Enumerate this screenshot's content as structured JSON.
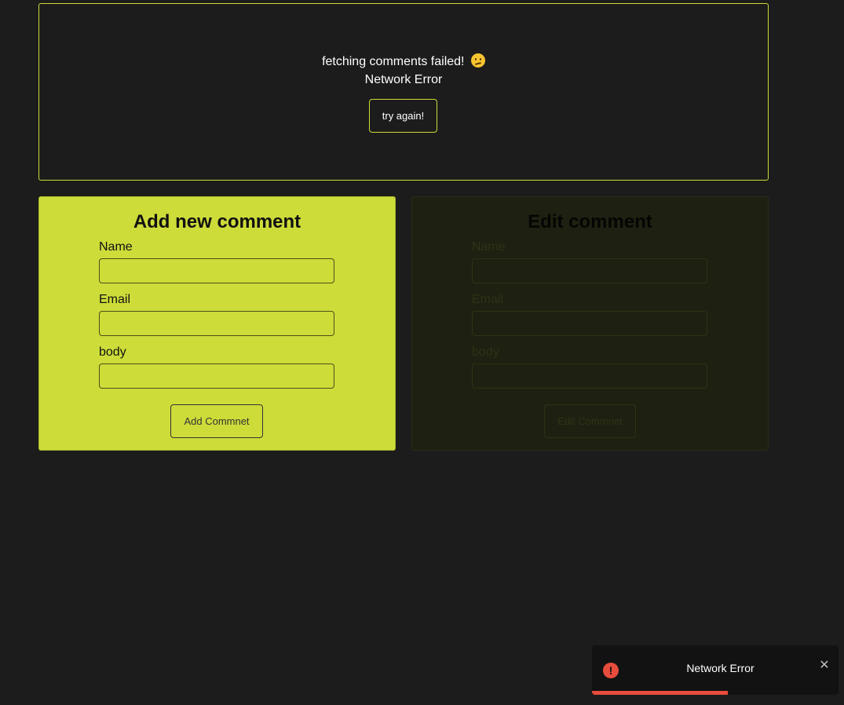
{
  "error_panel": {
    "message": "fetching comments failed!",
    "emoji_icon": "confused-face-icon",
    "detail": "Network Error",
    "retry_label": "try again!"
  },
  "add_form": {
    "title": "Add new comment",
    "name_label": "Name",
    "name_value": "",
    "email_label": "Email",
    "email_value": "",
    "body_label": "body",
    "body_value": "",
    "submit_label": "Add Commnet"
  },
  "edit_form": {
    "title": "Edit comment",
    "name_label": "Name",
    "name_value": "",
    "email_label": "Email",
    "email_value": "",
    "body_label": "body",
    "body_value": "",
    "submit_label": "Edit Commnet"
  },
  "toast": {
    "icon": "error-icon",
    "icon_glyph": "!",
    "message": "Network Error",
    "close_glyph": "✕",
    "progress_percent": 55
  },
  "colors": {
    "background": "#1c1c1c",
    "accent": "#cddc39",
    "error": "#e74c3c"
  }
}
